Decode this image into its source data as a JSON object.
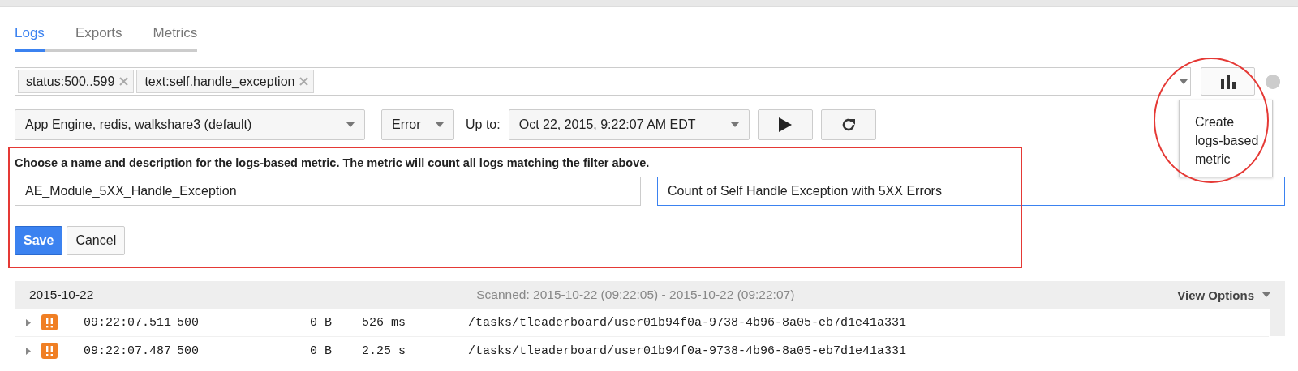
{
  "tabs": [
    {
      "label": "Logs",
      "selected": true
    },
    {
      "label": "Exports",
      "selected": false
    },
    {
      "label": "Metrics",
      "selected": false
    }
  ],
  "filter": {
    "chips": [
      "status:500..599",
      "text:self.handle_exception"
    ],
    "tooltip": "Create logs-based metric"
  },
  "controls": {
    "resource": "App Engine, redis, walkshare3 (default)",
    "severity": "Error",
    "up_to_label": "Up to:",
    "date": "Oct 22, 2015, 9:22:07 AM EDT"
  },
  "metric_form": {
    "instructions": "Choose a name and description for the logs-based metric. The metric will count all logs matching the filter above.",
    "name_value": "AE_Module_5XX_Handle_Exception",
    "name_focused": false,
    "description_value": "Count of Self Handle Exception with 5XX Errors",
    "description_focused": true,
    "buttons": [
      {
        "label": "Save",
        "kind": "primary"
      },
      {
        "label": "Cancel",
        "kind": "secondary"
      }
    ]
  },
  "logs": {
    "date": "2015-10-22",
    "scanned": "Scanned: 2015-10-22 (09:22:05) - 2015-10-22 (09:22:07)",
    "view_options": "View Options",
    "rows": [
      {
        "time": "09:22:07.511",
        "status": "500",
        "size": "0 B",
        "latency": "526 ms",
        "path": "/tasks/tleaderboard/user01b94f0a-9738-4b96-8a05-eb7d1e41a331"
      },
      {
        "time": "09:22:07.487",
        "status": "500",
        "size": "0 B",
        "latency": "2.25 s",
        "path": "/tasks/tleaderboard/user01b94f0a-9738-4b96-8a05-eb7d1e41a331"
      }
    ]
  }
}
